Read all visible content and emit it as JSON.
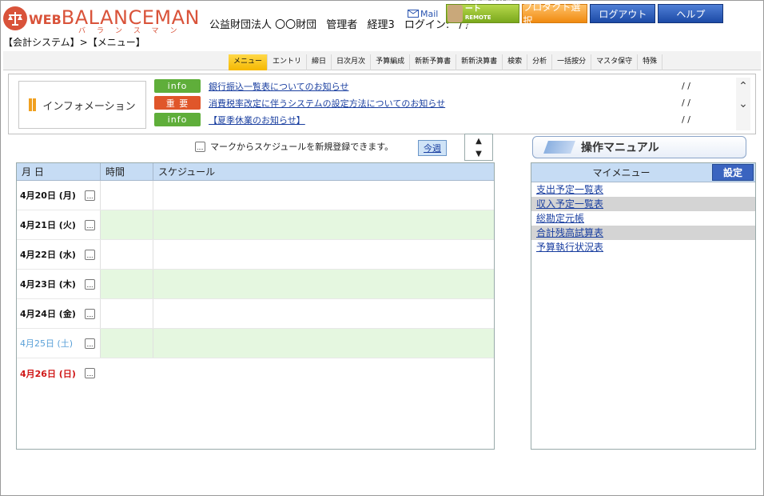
{
  "header": {
    "logo_prefix": "WEB",
    "logo_name": "BALANCEMAN",
    "logo_kana": "バランスマン",
    "org": "公益財団法人 〇〇財団",
    "role": "管理者",
    "user": "経理3",
    "login_label": "ログイン:",
    "login_value": "/ /",
    "breadcrumb": "【会計システム】>【メニュー】"
  },
  "top_buttons": {
    "mail": "Mail",
    "remote_line1": "リモートサポート",
    "remote_line2": "REMOTE SUPPORT",
    "product": "プロダクト選択",
    "logout": "ログアウト",
    "help": "ヘルプ"
  },
  "nav": {
    "items": [
      "メニュー",
      "エントリ",
      "締日",
      "日次月次",
      "予算編成",
      "新新予算書",
      "新新決算書",
      "検索",
      "分析",
      "一括按分",
      "マスタ保守",
      "特殊"
    ]
  },
  "info": {
    "title": "インフォメーション",
    "items": [
      {
        "badge": "info",
        "text": "銀行振込一覧表についてのお知らせ",
        "date": "/ /"
      },
      {
        "badge": "重 要",
        "text": "消費税率改定に伴うシステムの設定方法についてのお知らせ",
        "date": "/ /"
      },
      {
        "badge": "info",
        "text": "【夏季休業のお知らせ】",
        "date": "/ /"
      }
    ]
  },
  "schedule": {
    "hint": "マークからスケジュールを新規登録できます。",
    "today": "今週",
    "col_date": "月 日",
    "col_time": "時間",
    "col_sched": "スケジュール",
    "rows": [
      {
        "date": "4月20日 (月)"
      },
      {
        "date": "4月21日 (火)"
      },
      {
        "date": "4月22日 (水)"
      },
      {
        "date": "4月23日 (木)"
      },
      {
        "date": "4月24日 (金)"
      },
      {
        "date": "4月25日 (土)"
      },
      {
        "date": "4月26日 (日)"
      }
    ]
  },
  "manual": {
    "label": "操作マニュアル"
  },
  "mymenu": {
    "title": "マイメニュー",
    "settings": "設定",
    "items": [
      "支出予定一覧表",
      "収入予定一覧表",
      "総勘定元帳",
      "合計残高試算表",
      "予算執行状況表"
    ]
  },
  "colors": {
    "brand": "#d9533a",
    "nav_active": "#f5b800",
    "header_blue": "#c6dcf4",
    "weekday_green_row": "#e5f7e0",
    "saturday": "#5aa0d8",
    "sunday": "#d01818"
  }
}
